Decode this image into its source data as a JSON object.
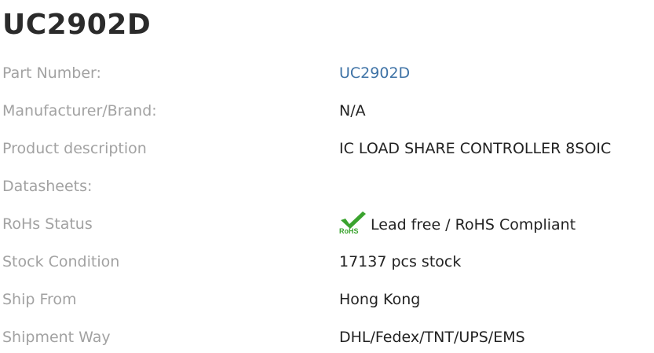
{
  "product": {
    "title": "UC2902D"
  },
  "specs": [
    {
      "label": "Part Number:",
      "value": "UC2902D",
      "is_link": true
    },
    {
      "label": "Manufacturer/Brand:",
      "value": "N/A"
    },
    {
      "label": "Product description",
      "value": "IC LOAD SHARE CONTROLLER 8SOIC"
    },
    {
      "label": "Datasheets:",
      "value": ""
    },
    {
      "label": "RoHs Status",
      "value": "Lead free / RoHS Compliant",
      "badge": {
        "icon": "rohs-check-icon",
        "text": "RoHS"
      }
    },
    {
      "label": "Stock Condition",
      "value": "17137 pcs stock"
    },
    {
      "label": "Ship From",
      "value": "Hong Kong"
    },
    {
      "label": "Shipment Way",
      "value": "DHL/Fedex/TNT/UPS/EMS"
    }
  ],
  "colors": {
    "title": "#2b2b2b",
    "label": "#a2a2a2",
    "value": "#222222",
    "link": "#3f73a6",
    "rohs_check": "#3aa32e"
  }
}
